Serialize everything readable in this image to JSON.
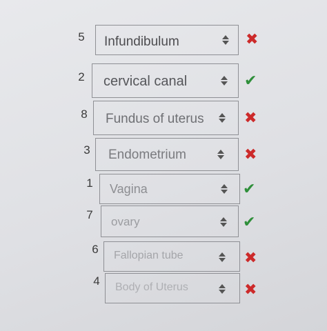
{
  "answers": [
    {
      "number": "5",
      "value": "Infundibulum",
      "status": "wrong",
      "mark": "✖"
    },
    {
      "number": "2",
      "value": "cervical canal",
      "status": "correct",
      "mark": "✔"
    },
    {
      "number": "8",
      "value": "Fundus of uterus",
      "status": "wrong",
      "mark": "✖"
    },
    {
      "number": "3",
      "value": "Endometrium",
      "status": "wrong",
      "mark": "✖"
    },
    {
      "number": "1",
      "value": "Vagina",
      "status": "correct",
      "mark": "✔"
    },
    {
      "number": "7",
      "value": "ovary",
      "status": "correct",
      "mark": "✔"
    },
    {
      "number": "6",
      "value": "Fallopian tube",
      "status": "wrong",
      "mark": "✖"
    },
    {
      "number": "4",
      "value": "Body of Uterus",
      "status": "wrong",
      "mark": "✖"
    }
  ],
  "colors": {
    "wrong": "#cc2a2a",
    "correct": "#2f8f3a"
  }
}
